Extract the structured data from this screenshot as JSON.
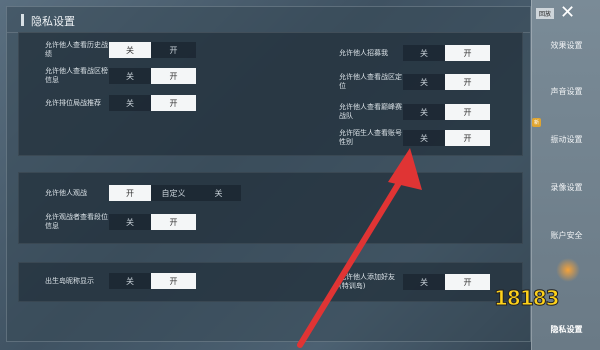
{
  "header": {
    "title": "隐私设置"
  },
  "toggle": {
    "off": "关",
    "on": "开"
  },
  "panel1": {
    "left": [
      {
        "label": "允许他人查看历史战绩",
        "state": "off"
      },
      {
        "label": "允许他人查看战区榜信息",
        "state": "on"
      },
      {
        "label": "允许排位局战推荐",
        "state": "on"
      }
    ],
    "right": [
      {
        "label": "允许他人招募我",
        "state": "on"
      },
      {
        "label": "允许他人查看战区定位",
        "state": "on"
      },
      {
        "label": "允许他人查看巅峰赛战队",
        "state": "on"
      },
      {
        "label": "允许陌生人查看账号性别",
        "state": "on"
      }
    ]
  },
  "panel2": {
    "row1": {
      "label": "允许他人观战",
      "opt_on": "开",
      "opt_custom": "自定义",
      "opt_off": "关"
    },
    "row2": {
      "label": "允许观战者查看段位信息",
      "state": "on"
    }
  },
  "panel3": {
    "left": {
      "label": "出生岛昵称显示",
      "state": "on"
    },
    "right": {
      "label": "允许他人添加好友(特训岛)",
      "state": "on"
    }
  },
  "sidebar": {
    "close_small": "回放",
    "badge": "新",
    "items": [
      "效果设置",
      "声音设置",
      "振动设置",
      "录像设置",
      "账户安全",
      "隐私设置"
    ]
  },
  "watermark": {
    "text": "18183"
  },
  "colors": {
    "arrow": "#e03434",
    "toggle_on": "#f4f6f7",
    "watermark": "#ffd21a"
  }
}
